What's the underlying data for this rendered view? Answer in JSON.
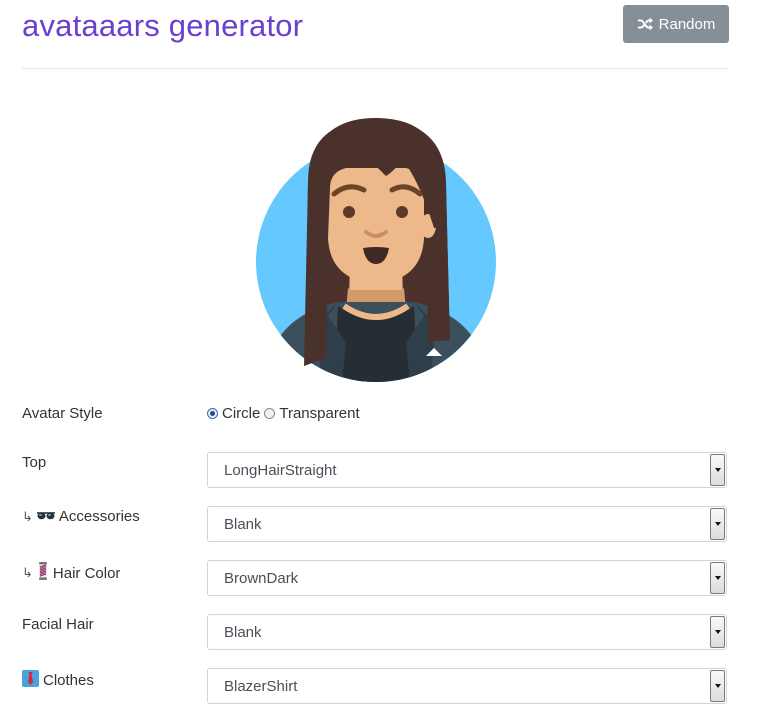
{
  "header": {
    "title": "avataaars generator",
    "random_label": "Random"
  },
  "avatar": {
    "style": "Circle",
    "background_color": "#65c9ff",
    "skin_color": "#edb98a",
    "hair_color": "#4a312c",
    "clothes_color": "#3c4f5c",
    "shirt_color": "#262e33"
  },
  "form": {
    "avatar_style": {
      "label": "Avatar Style",
      "options": [
        "Circle",
        "Transparent"
      ],
      "selected": "Circle"
    },
    "top": {
      "label": "Top",
      "value": "LongHairStraight"
    },
    "accessories": {
      "prefix": "↳",
      "icon": "sunglasses-icon",
      "label": "Accessories",
      "value": "Blank"
    },
    "hair_color": {
      "prefix": "↳",
      "icon": "barber-pole-icon",
      "label": "Hair Color",
      "value": "BrownDark"
    },
    "facial_hair": {
      "label": "Facial Hair",
      "value": "Blank"
    },
    "clothes": {
      "icon": "necktie-icon",
      "label": "Clothes",
      "value": "BlazerShirt"
    }
  },
  "colors": {
    "title": "#6a3fd1",
    "button_bg": "#868e96"
  }
}
